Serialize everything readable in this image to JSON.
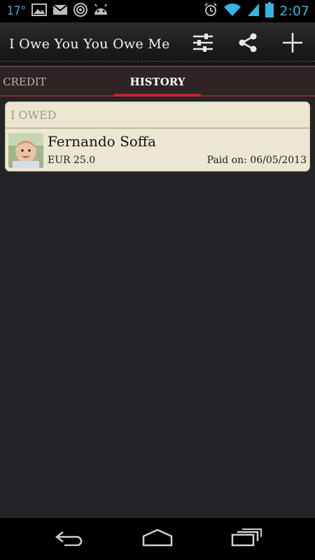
{
  "status_bar": {
    "temperature": "17°",
    "time": "2:07",
    "icons": [
      "image-icon",
      "gmail-icon",
      "radio-icon",
      "android-icon",
      "alarm-icon",
      "wifi-icon",
      "signal-icon",
      "battery-icon"
    ]
  },
  "action_bar": {
    "title": "I Owe You You Owe Me",
    "actions": [
      "settings-sliders-icon",
      "share-icon",
      "add-icon"
    ]
  },
  "tabs": [
    {
      "label": "CREDIT",
      "selected": false
    },
    {
      "label": "HISTORY",
      "selected": true
    }
  ],
  "history": {
    "section_header": "I OWED",
    "entries": [
      {
        "name": "Fernando Soffa",
        "amount": "EUR 25.0",
        "paid_on": "Paid on: 06/05/2013"
      }
    ]
  },
  "colors": {
    "accent_blue": "#33b5e5",
    "tab_indicator": "#c0282a",
    "card_bg": "#ece7d2",
    "background": "#232427"
  },
  "nav_bar": {
    "buttons": [
      "back-icon",
      "home-icon",
      "recents-icon"
    ]
  }
}
